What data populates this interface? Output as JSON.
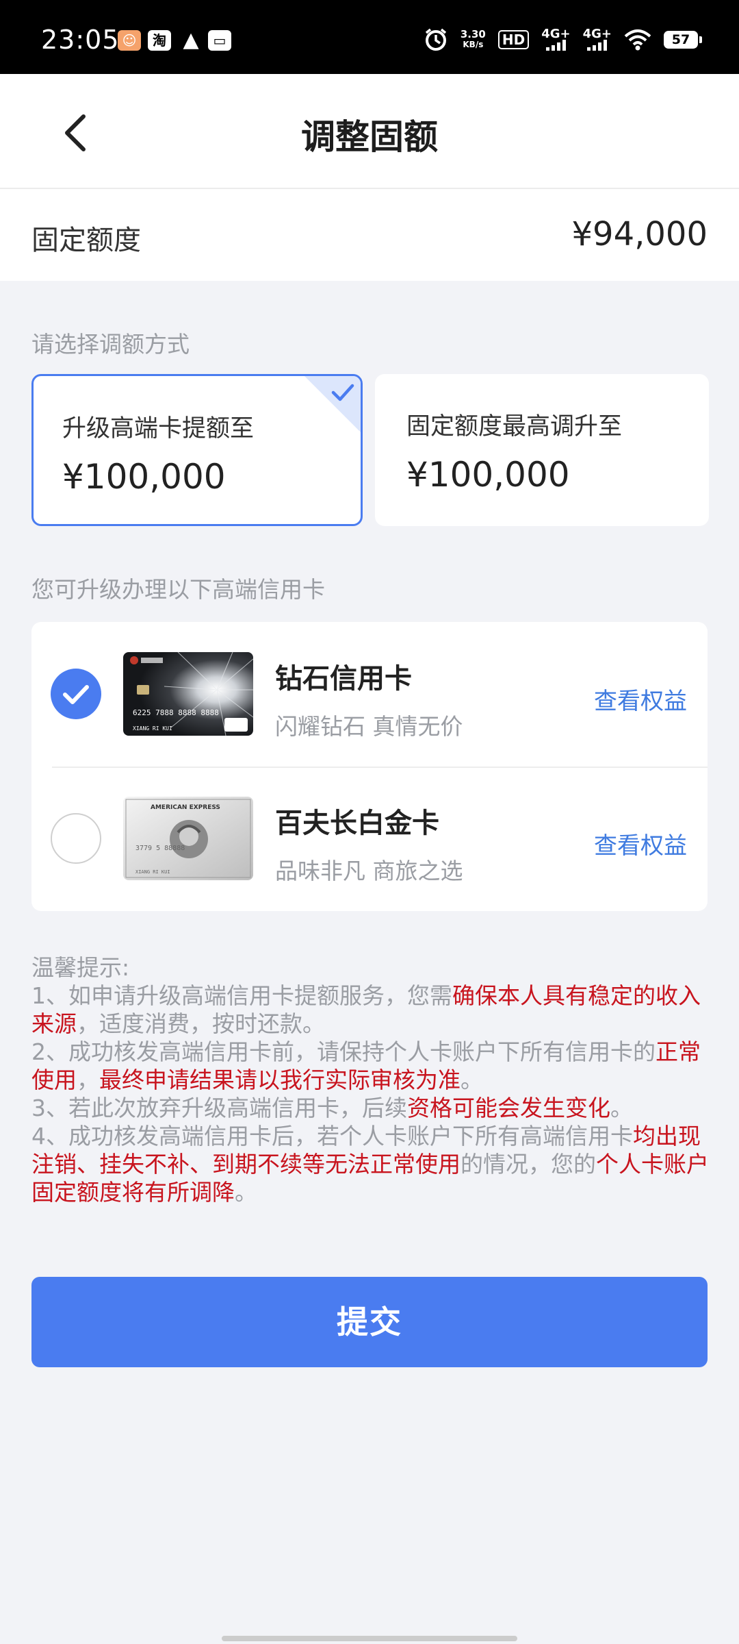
{
  "status_bar": {
    "time": "23:05",
    "app_icons": [
      "taobao-like-icon",
      "淘",
      "qq-icon",
      "wallet-icon"
    ],
    "speed_value": "3.30",
    "speed_unit": "KB/s",
    "hd_badge": "HD",
    "net1": "4G+",
    "net2": "4G+",
    "battery": "57"
  },
  "nav": {
    "title": "调整固额"
  },
  "fixed_limit": {
    "label": "固定额度",
    "value": "¥94,000"
  },
  "adjust_section": {
    "label": "请选择调额方式",
    "options": [
      {
        "label": "升级高端卡提额至",
        "value": "¥100,000",
        "selected": true
      },
      {
        "label": "固定额度最高调升至",
        "value": "¥100,000",
        "selected": false
      }
    ]
  },
  "cards_section": {
    "label": "您可升级办理以下高端信用卡",
    "cards": [
      {
        "name": "钻石信用卡",
        "subtitle": "闪耀钻石 真情无价",
        "link": "查看权益",
        "selected": true,
        "art_number": "6225 7888 8888 8888",
        "art_holder": "XIANG RI KUI"
      },
      {
        "name": "百夫长白金卡",
        "subtitle": "品味非凡 商旅之选",
        "link": "查看权益",
        "selected": false,
        "art_brand": "AMERICAN EXPRESS",
        "art_number": "3779 5 88888",
        "art_holder": "XIANG RI KUI"
      }
    ]
  },
  "tips": {
    "title": "温馨提示:",
    "t1a": "1、如申请升级高端信用卡提额服务，您需",
    "t1b": "确保本人具有稳定的收入来源",
    "t1c": "，适度消费，按时还款。",
    "t2a": "2、成功核发高端信用卡前，请保持个人卡账户下所有信用卡的",
    "t2b": "正常使用",
    "t2c": "，",
    "t2d": "最终申请结果请以我行实际审核为准",
    "t2e": "。",
    "t3a": "3、若此次放弃升级高端信用卡，后续",
    "t3b": "资格可能会发生变化",
    "t3c": "。",
    "t4a": "4、成功核发高端信用卡后，若个人卡账户下所有高端信用卡",
    "t4b": "均出现注销、挂失不补、到期不续等无法正常使用",
    "t4c": "的情况，您的",
    "t4d": "个人卡账户固定额度将有所调降",
    "t4e": "。"
  },
  "submit_label": "提交",
  "colors": {
    "accent": "#4A7CF0",
    "link": "#3F7BE0",
    "warning_red": "#C8141E",
    "background": "#F2F3F7"
  }
}
